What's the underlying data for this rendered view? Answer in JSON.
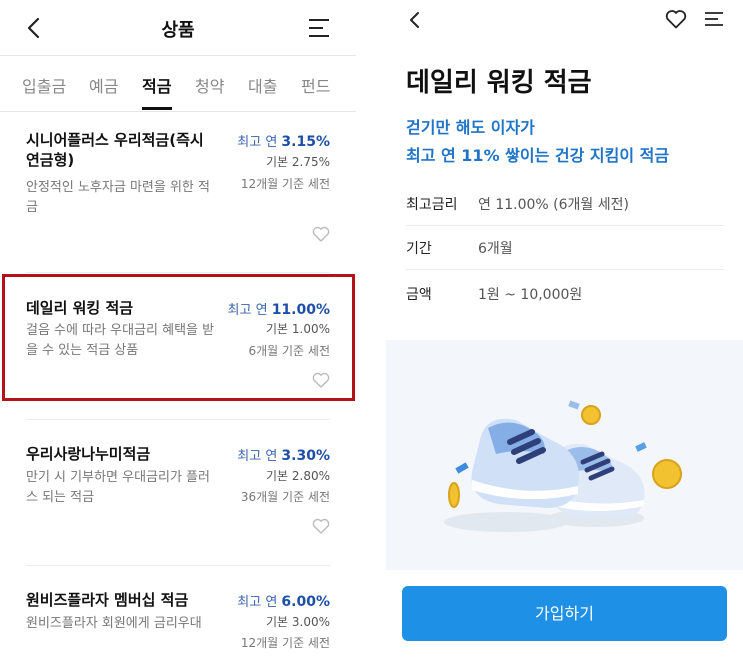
{
  "left_screen": {
    "header": {
      "title": "상품"
    },
    "tabs": [
      {
        "label": "입출금"
      },
      {
        "label": "예금"
      },
      {
        "label": "적금"
      },
      {
        "label": "청약"
      },
      {
        "label": "대출"
      },
      {
        "label": "펀드"
      }
    ],
    "active_tab": "적금",
    "products": [
      {
        "name": "시니어플러스 우리적금(즉시연금형)",
        "desc": "안정적인 노후자금 마련을 위한 적금",
        "rate_prefix": "최고 연",
        "rate": "3.15%",
        "base": "기본 2.75%",
        "term": "12개월 기준 세전"
      },
      {
        "name": "데일리 워킹 적금",
        "desc": "걸음 수에 따라 우대금리 혜택을 받을 수 있는 적금 상품",
        "rate_prefix": "최고 연",
        "rate": "11.00%",
        "base": "기본 1.00%",
        "term": "6개월 기준 세전"
      },
      {
        "name": "우리사랑나누미적금",
        "desc": "만기 시 기부하면 우대금리가 플러스 되는 적금",
        "rate_prefix": "최고 연",
        "rate": "3.30%",
        "base": "기본 2.80%",
        "term": "36개월 기준 세전"
      },
      {
        "name": "원비즈플라자 멤버십 적금",
        "desc": "원비즈플라자 회원에게 금리우대",
        "rate_prefix": "최고 연",
        "rate": "6.00%",
        "base": "기본 3.00%",
        "term": "12개월 기준 세전"
      }
    ]
  },
  "right_screen": {
    "title": "데일리 워킹 적금",
    "subtitle_line1": "걷기만 해도 이자가",
    "subtitle_line2": "최고 연 11% 쌓이는 건강 지킴이 적금",
    "info": [
      {
        "label": "최고금리",
        "value": "연 11.00% (6개월 세전)"
      },
      {
        "label": "기간",
        "value": "6개월"
      },
      {
        "label": "금액",
        "value": "1원 ~ 10,000원"
      }
    ],
    "join_button": "가입하기"
  },
  "colors": {
    "accent_blue": "#1e90e6",
    "rate_blue": "#1e4fa8",
    "highlight_red": "#b3121a",
    "subtitle_blue": "#1f74c8"
  },
  "icons": [
    "back-icon",
    "menu-icon",
    "heart-icon",
    "shoes-illustration"
  ]
}
